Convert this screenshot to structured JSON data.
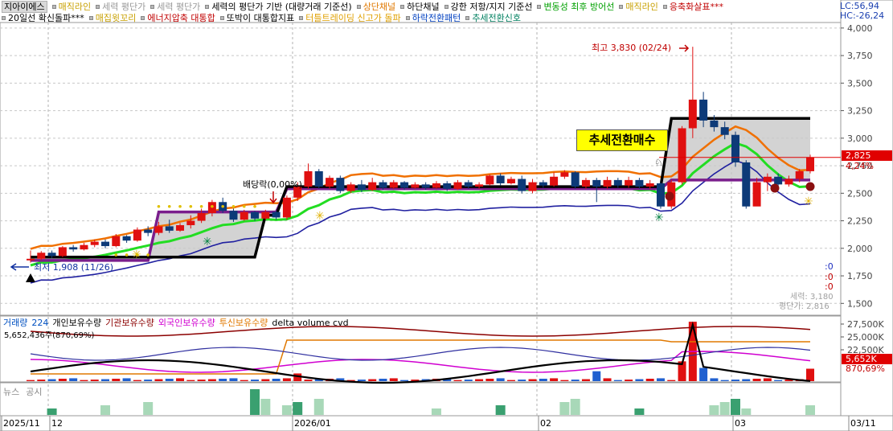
{
  "legend_row1": [
    {
      "label": "지아이에스",
      "color": "#000000",
      "chip": true
    },
    {
      "label": "매직라인",
      "color": "#c8a000"
    },
    {
      "label": "세력 평단가",
      "color": "#999999"
    },
    {
      "label": "세력 평단가",
      "color": "#999999"
    },
    {
      "label": "세력의 평단가 기반 (대량거래 기준선)",
      "color": "#000000"
    },
    {
      "label": "상단채널",
      "color": "#e07800"
    },
    {
      "label": "하단채널",
      "color": "#000000"
    },
    {
      "label": "강한 저항/지지 기준선",
      "color": "#000000"
    },
    {
      "label": "변동성 최후 방어선",
      "color": "#00a000"
    },
    {
      "label": "매직라인",
      "color": "#c8a000"
    },
    {
      "label": "응축화살표***",
      "color": "#c00000"
    }
  ],
  "legend_row2": [
    {
      "label": "20일선 확신돌파***",
      "color": "#000000"
    },
    {
      "label": "매집윗꼬리",
      "color": "#c8a000"
    },
    {
      "label": "에너지압축 대통합",
      "color": "#c00000"
    },
    {
      "label": "또박이 대통합지표",
      "color": "#000000"
    },
    {
      "label": "터틀트레이딩 신고가 돌파",
      "color": "#e0a000"
    },
    {
      "label": "하락전환패턴",
      "color": "#0040c0"
    },
    {
      "label": "추세전환신호",
      "color": "#008060"
    }
  ],
  "header_right": {
    "lc": "LC:56,94",
    "hc": "HC:-26,24"
  },
  "price_axis": {
    "ticks": [
      "4,000",
      "3,750",
      "3,500",
      "3,250",
      "3,000",
      "2,750",
      "2,500",
      "2,250",
      "2,000",
      "1,750",
      "1,500"
    ],
    "min": 1400,
    "max": 4050
  },
  "current_price": {
    "label": "2,825",
    "pct": "4,24%",
    "color": "#e00000"
  },
  "annotations": {
    "high": "최고 3,830 (02/24)",
    "low": "최저 1,908 (11/26)",
    "dividend": "배당락(0,00%)",
    "trend_buy": "추세전환매수",
    "force_label": "세력: 3,180",
    "avg_label": "평단가: 2,816",
    "zeros": [
      ":0",
      ":0",
      ":0"
    ]
  },
  "volume_legend": [
    {
      "label": "거래량",
      "color": "#0050c0"
    },
    {
      "label": "224",
      "color": "#0050c0"
    },
    {
      "label": "개인보유수량",
      "color": "#000000"
    },
    {
      "label": "기관보유수량",
      "color": "#8b0000"
    },
    {
      "label": "외국인보유수량",
      "color": "#d000d0"
    },
    {
      "label": "투신보유수량",
      "color": "#e07800"
    },
    {
      "label": "delta volume cvd",
      "color": "#000000"
    }
  ],
  "volume_sub": "5,652,436주(870,69%)",
  "volume_axis": {
    "ticks": [
      "27,500K",
      "25,000K",
      "22,500K"
    ],
    "value_label": "5,652K",
    "pct_label": "870,69%"
  },
  "news_legend": [
    {
      "label": "뉴스",
      "color": "#888888"
    },
    {
      "label": "공시",
      "color": "#888888"
    }
  ],
  "date_axis": [
    "2025/11",
    "12",
    "2026/01",
    "02",
    "03",
    "03/11"
  ],
  "chart_data": {
    "type": "candlestick",
    "title": "지아이에스",
    "ylim": [
      1400,
      4050
    ],
    "high_marker": {
      "value": 3830,
      "date": "02/24"
    },
    "low_marker": {
      "value": 1908,
      "date": "11/26"
    },
    "candles": [
      [
        1900,
        1905,
        1870,
        1980
      ],
      [
        1905,
        1960,
        1890,
        1975
      ],
      [
        1960,
        1930,
        1910,
        1980
      ],
      [
        1930,
        2010,
        1920,
        2020
      ],
      [
        2010,
        1990,
        1970,
        2030
      ],
      [
        1990,
        2030,
        1980,
        2050
      ],
      [
        2030,
        2060,
        2010,
        2080
      ],
      [
        2060,
        2020,
        2000,
        2080
      ],
      [
        2020,
        2110,
        2010,
        2130
      ],
      [
        2110,
        2070,
        2050,
        2120
      ],
      [
        2070,
        2170,
        2060,
        2190
      ],
      [
        2170,
        2140,
        2110,
        2200
      ],
      [
        2140,
        2200,
        2120,
        2240
      ],
      [
        2200,
        2160,
        2140,
        2260
      ],
      [
        2160,
        2210,
        2150,
        2230
      ],
      [
        2210,
        2250,
        2180,
        2300
      ],
      [
        2250,
        2320,
        2230,
        2360
      ],
      [
        2320,
        2420,
        2290,
        2440
      ],
      [
        2420,
        2340,
        2320,
        2460
      ],
      [
        2340,
        2260,
        2240,
        2360
      ],
      [
        2260,
        2330,
        2250,
        2350
      ],
      [
        2330,
        2270,
        2250,
        2340
      ],
      [
        2270,
        2330,
        2260,
        2350
      ],
      [
        2330,
        2280,
        2260,
        2340
      ],
      [
        2280,
        2460,
        2260,
        2480
      ],
      [
        2460,
        2560,
        2430,
        2600
      ],
      [
        2560,
        2700,
        2540,
        2770
      ],
      [
        2700,
        2560,
        2540,
        2720
      ],
      [
        2560,
        2640,
        2540,
        2660
      ],
      [
        2640,
        2520,
        2500,
        2660
      ],
      [
        2520,
        2580,
        2500,
        2600
      ],
      [
        2580,
        2530,
        2510,
        2620
      ],
      [
        2530,
        2600,
        2520,
        2640
      ],
      [
        2600,
        2550,
        2530,
        2620
      ],
      [
        2550,
        2600,
        2540,
        2620
      ],
      [
        2600,
        2550,
        2530,
        2610
      ],
      [
        2550,
        2580,
        2540,
        2600
      ],
      [
        2580,
        2550,
        2530,
        2600
      ],
      [
        2550,
        2590,
        2540,
        2610
      ],
      [
        2590,
        2540,
        2520,
        2610
      ],
      [
        2540,
        2600,
        2530,
        2620
      ],
      [
        2600,
        2560,
        2540,
        2620
      ],
      [
        2560,
        2580,
        2540,
        2600
      ],
      [
        2580,
        2660,
        2570,
        2670
      ],
      [
        2660,
        2590,
        2570,
        2680
      ],
      [
        2590,
        2630,
        2580,
        2650
      ],
      [
        2630,
        2520,
        2500,
        2660
      ],
      [
        2520,
        2600,
        2500,
        2630
      ],
      [
        2600,
        2570,
        2550,
        2620
      ],
      [
        2570,
        2650,
        2560,
        2690
      ],
      [
        2650,
        2690,
        2630,
        2710
      ],
      [
        2690,
        2560,
        2540,
        2700
      ],
      [
        2560,
        2620,
        2540,
        2640
      ],
      [
        2620,
        2560,
        2420,
        2640
      ],
      [
        2560,
        2620,
        2540,
        2650
      ],
      [
        2620,
        2570,
        2550,
        2640
      ],
      [
        2570,
        2620,
        2550,
        2650
      ],
      [
        2620,
        2560,
        2540,
        2640
      ],
      [
        2560,
        2590,
        2540,
        2620
      ],
      [
        2590,
        2380,
        2360,
        2600
      ],
      [
        2380,
        2600,
        2360,
        2620
      ],
      [
        2600,
        3090,
        2580,
        3110
      ],
      [
        3090,
        3350,
        3000,
        3830
      ],
      [
        3350,
        3160,
        3100,
        3420
      ],
      [
        3160,
        3100,
        3060,
        3210
      ],
      [
        3100,
        3030,
        2990,
        3150
      ],
      [
        3030,
        2780,
        2740,
        3060
      ],
      [
        2780,
        2380,
        2360,
        2800
      ],
      [
        2380,
        2600,
        2540,
        2640
      ],
      [
        2600,
        2650,
        2520,
        2680
      ],
      [
        2650,
        2580,
        2540,
        2680
      ],
      [
        2580,
        2630,
        2560,
        2660
      ],
      [
        2630,
        2700,
        2600,
        2720
      ],
      [
        2700,
        2825,
        2680,
        2850
      ]
    ]
  }
}
